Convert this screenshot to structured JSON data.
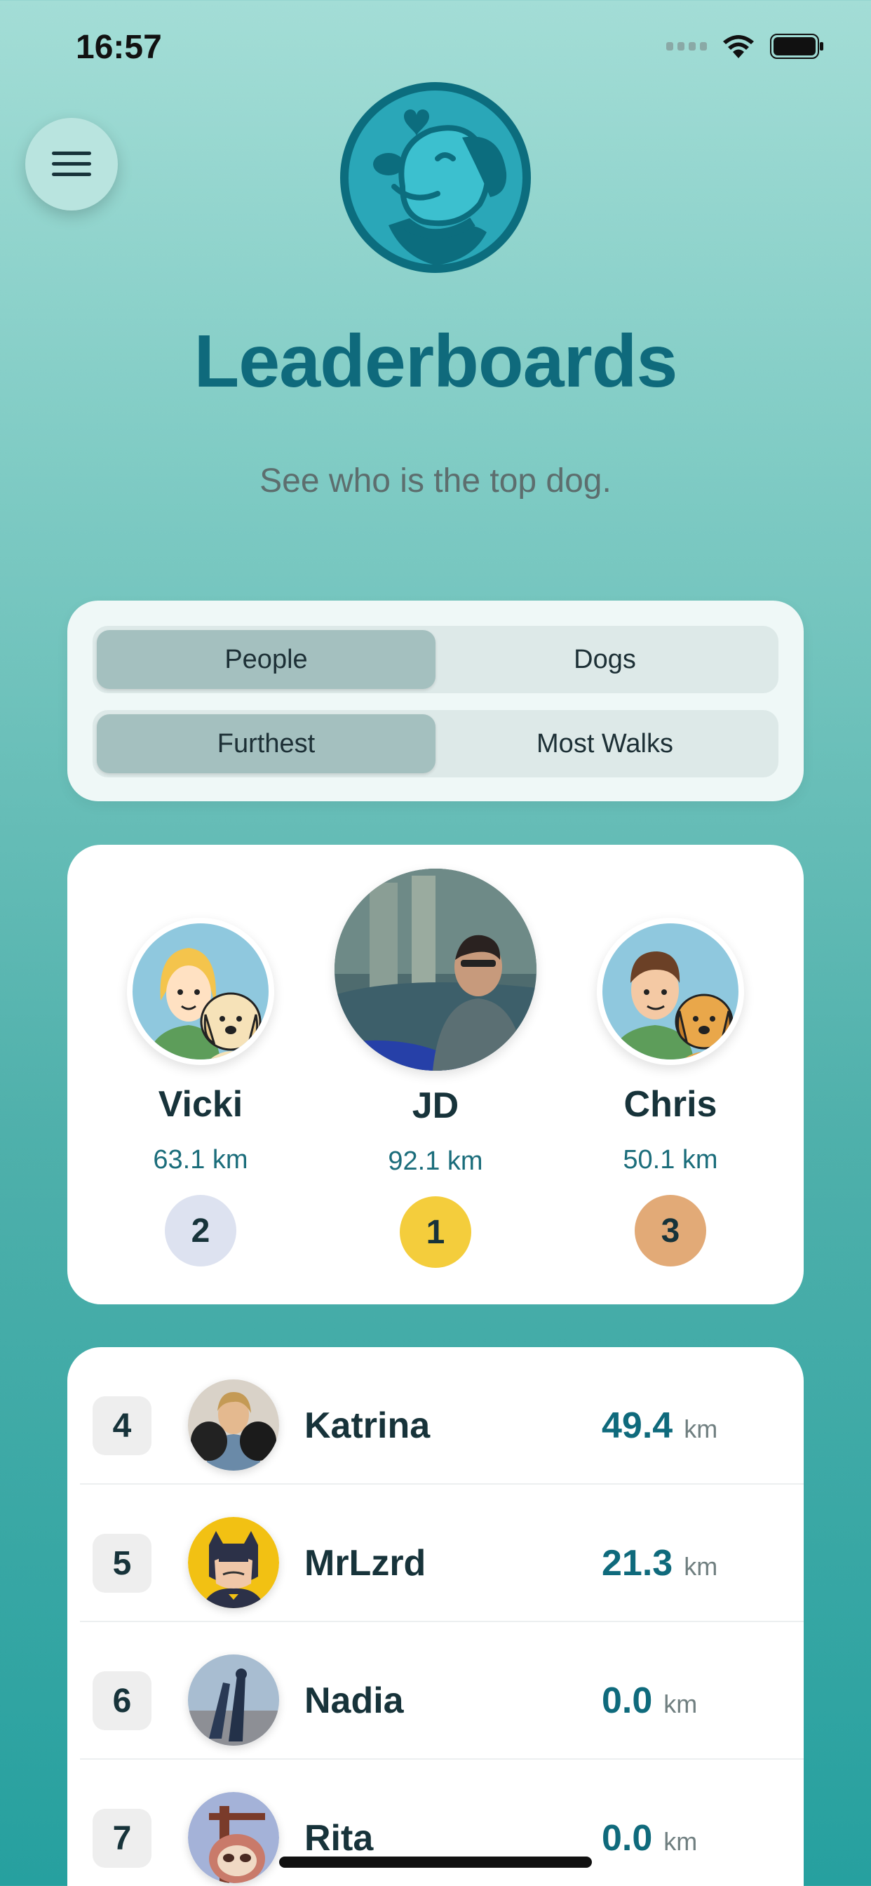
{
  "status_bar": {
    "time": "16:57"
  },
  "header": {
    "title": "Leaderboards",
    "subtitle": "See who is the top dog."
  },
  "filters": {
    "subject": {
      "options": [
        "People",
        "Dogs"
      ],
      "selected": "People"
    },
    "metric": {
      "options": [
        "Furthest",
        "Most Walks"
      ],
      "selected": "Furthest"
    }
  },
  "podium": [
    {
      "rank": "2",
      "name": "Vicki",
      "distance": "63.1 km",
      "badge_color": "#dde2f0"
    },
    {
      "rank": "1",
      "name": "JD",
      "distance": "92.1 km",
      "badge_color": "#f4cd3c"
    },
    {
      "rank": "3",
      "name": "Chris",
      "distance": "50.1 km",
      "badge_color": "#e2aa77"
    }
  ],
  "list": [
    {
      "rank": "4",
      "name": "Katrina",
      "value": "49.4",
      "unit": "km"
    },
    {
      "rank": "5",
      "name": "MrLzrd",
      "value": "21.3",
      "unit": "km"
    },
    {
      "rank": "6",
      "name": "Nadia",
      "value": "0.0",
      "unit": "km"
    },
    {
      "rank": "7",
      "name": "Rita",
      "value": "0.0",
      "unit": "km"
    }
  ],
  "icons": {
    "menu": "hamburger-menu-icon",
    "logo": "dog-heart-logo",
    "wifi": "wifi-icon",
    "battery": "battery-icon",
    "signal": "signal-icon"
  },
  "colors": {
    "accent": "#0f6a7c",
    "selected_segment": "#a4c0bf"
  }
}
